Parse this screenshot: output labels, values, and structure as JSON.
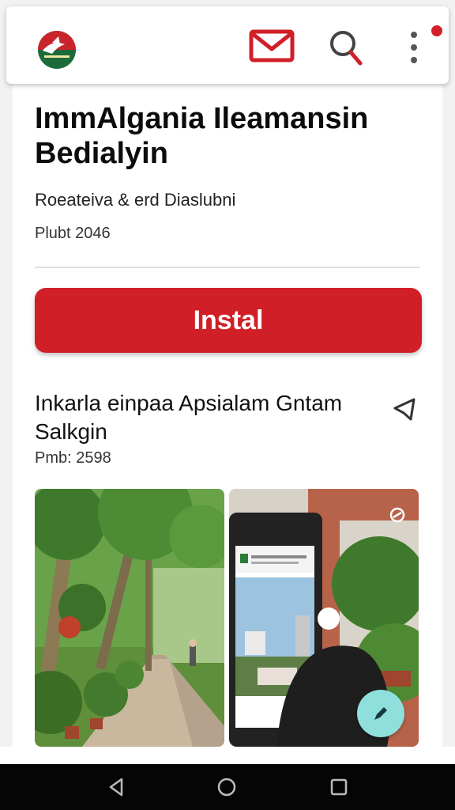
{
  "header": {
    "icons": [
      "app-logo",
      "mail-icon",
      "search-icon",
      "more-vert-icon"
    ],
    "notification_dot": true
  },
  "app": {
    "title": "ImmAlgania Ileamansin Bedialyin",
    "developer": "Roeateiva & erd Diaslubni",
    "published": "Plubt 2046",
    "install_label": "Instal"
  },
  "section": {
    "title": "Inkarla einpaa Apsialam Gntam Salkgin",
    "date": "Pmb: 2598",
    "share_icon": "share-icon"
  },
  "colors": {
    "accent": "#d01f27",
    "fab": "#8fe0dc",
    "nav_bar": "#050505"
  },
  "navigation": {
    "buttons": [
      "back",
      "home",
      "recents"
    ]
  }
}
